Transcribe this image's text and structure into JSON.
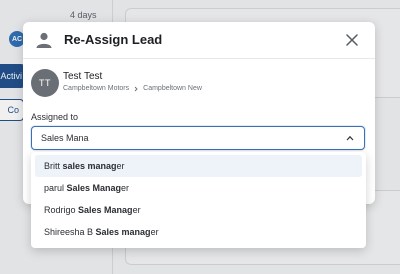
{
  "background": {
    "days": "4 days",
    "avatar_initials": "AC",
    "activity_label": "Activi",
    "co_label": "Co"
  },
  "modal": {
    "title": "Re-Assign Lead",
    "lead": {
      "initials": "TT",
      "name": "Test Test",
      "company": "Campbeltown Motors",
      "location": "Campbeltown New"
    },
    "assigned_label": "Assigned to",
    "assigned_value": "Sales Mana",
    "icons": [
      "person-icon",
      "close-icon",
      "chevron-right-icon",
      "chevron-up-icon"
    ]
  },
  "dropdown": {
    "options": [
      {
        "prefix": "Britt ",
        "match": "sales manag",
        "suffix": "er",
        "active": true
      },
      {
        "prefix": "parul ",
        "match": "Sales Manag",
        "suffix": "er",
        "active": false
      },
      {
        "prefix": "Rodrigo ",
        "match": "Sales Manag",
        "suffix": "er",
        "active": false
      },
      {
        "prefix": "Shireesha B ",
        "match": "Sales manag",
        "suffix": "er",
        "active": false
      }
    ]
  },
  "colors": {
    "accent": "#3b6fb6",
    "nav_dark": "#1f4f8c",
    "avatar_grey": "#6a6f76",
    "highlight": "#eef3f9"
  }
}
